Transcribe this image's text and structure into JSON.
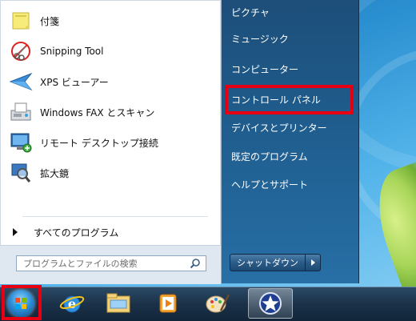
{
  "start_menu": {
    "programs": [
      {
        "label": "付箋",
        "icon": "sticky-notes-icon"
      },
      {
        "label": "Snipping Tool",
        "icon": "snipping-tool-icon"
      },
      {
        "label": "XPS ビューアー",
        "icon": "xps-viewer-icon"
      },
      {
        "label": "Windows FAX とスキャン",
        "icon": "fax-scan-icon"
      },
      {
        "label": "リモート デスクトップ接続",
        "icon": "remote-desktop-icon"
      },
      {
        "label": "拡大鏡",
        "icon": "magnifier-icon"
      }
    ],
    "all_programs_label": "すべてのプログラム",
    "search_placeholder": "プログラムとファイルの検索",
    "right_items": [
      {
        "label": "ピクチャ"
      },
      {
        "label": "ミュージック"
      },
      {
        "label": "コンピューター"
      },
      {
        "label": "コントロール パネル"
      },
      {
        "label": "デバイスとプリンター"
      },
      {
        "label": "既定のプログラム"
      },
      {
        "label": "ヘルプとサポート"
      }
    ],
    "shutdown_label": "シャットダウン"
  },
  "taskbar": {
    "items": [
      {
        "icon": "start-orb-icon"
      },
      {
        "icon": "internet-explorer-icon"
      },
      {
        "icon": "windows-explorer-icon"
      },
      {
        "icon": "media-player-icon"
      },
      {
        "icon": "paint-icon"
      },
      {
        "icon": "star-app-icon"
      }
    ]
  },
  "colors": {
    "highlight_red": "#e60012",
    "right_pane": "#1f5d8e",
    "taskbar": "#1a3148"
  }
}
